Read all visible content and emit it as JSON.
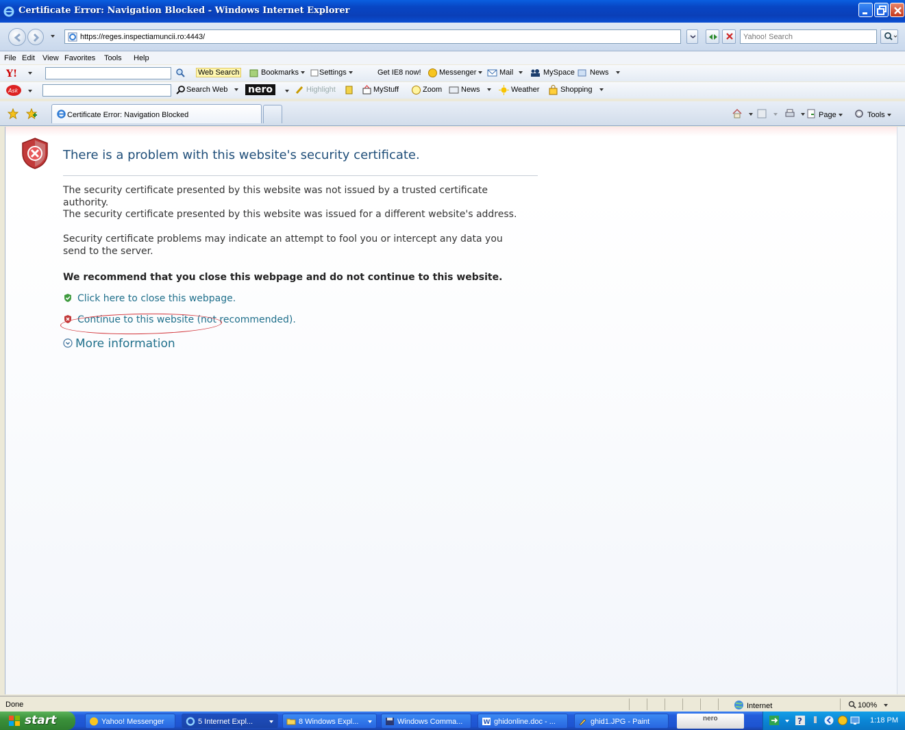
{
  "window": {
    "title": "Certificate Error: Navigation Blocked - Windows Internet Explorer"
  },
  "address_bar": {
    "url": "https://reges.inspectiamuncii.ro:4443/",
    "search_placeholder": "Yahoo! Search"
  },
  "menu": {
    "items": [
      "File",
      "Edit",
      "View",
      "Favorites",
      "Tools",
      "Help"
    ]
  },
  "yahoo_toolbar": {
    "web_search": "Web Search",
    "bookmarks": "Bookmarks",
    "settings": "Settings",
    "get_ie8": "Get IE8 now!",
    "messenger": "Messenger",
    "mail": "Mail",
    "myspace": "MySpace",
    "news": "News"
  },
  "ask_toolbar": {
    "search_web": "Search Web",
    "nero": "nero",
    "highlight": "Highlight",
    "mystuff": "MyStuff",
    "zoom": "Zoom",
    "news": "News",
    "weather": "Weather",
    "shopping": "Shopping"
  },
  "tabbar": {
    "tab_title": "Certificate Error: Navigation Blocked",
    "page_label": "Page",
    "tools_label": "Tools"
  },
  "content": {
    "title": "There is a problem with this website's security certificate.",
    "para1_line1": "The security certificate presented by this website was not issued by a trusted certificate",
    "para1_line2": "authority.",
    "para1_line3": "The security certificate presented by this website was issued for a different website's address.",
    "para2_line1": "Security certificate problems may indicate an attempt to fool you or intercept any data you",
    "para2_line2": "send to the server.",
    "recommendation": "We recommend that you close this webpage and do not continue to this website.",
    "close_link": "Click here to close this webpage.",
    "continue_link": "Continue to this website (not recommended).",
    "more_info": "More information"
  },
  "status": {
    "left": "Done",
    "zone": "Internet",
    "zoom": "100%"
  },
  "taskbar": {
    "start": "start",
    "tasks": [
      "Yahoo! Messenger",
      "5 Internet Expl...",
      "8 Windows Expl...",
      "Windows Comma...",
      "ghidonline.doc - ...",
      "ghid1.JPG - Paint"
    ],
    "nero_search": "nero",
    "clock": "1:18 PM"
  },
  "colors": {
    "title_blue": "#1f4e79",
    "link_teal": "#1f6f8b",
    "alert_red": "#d12f35",
    "xp_blue": "#245edb",
    "start_green": "#3b913b"
  }
}
